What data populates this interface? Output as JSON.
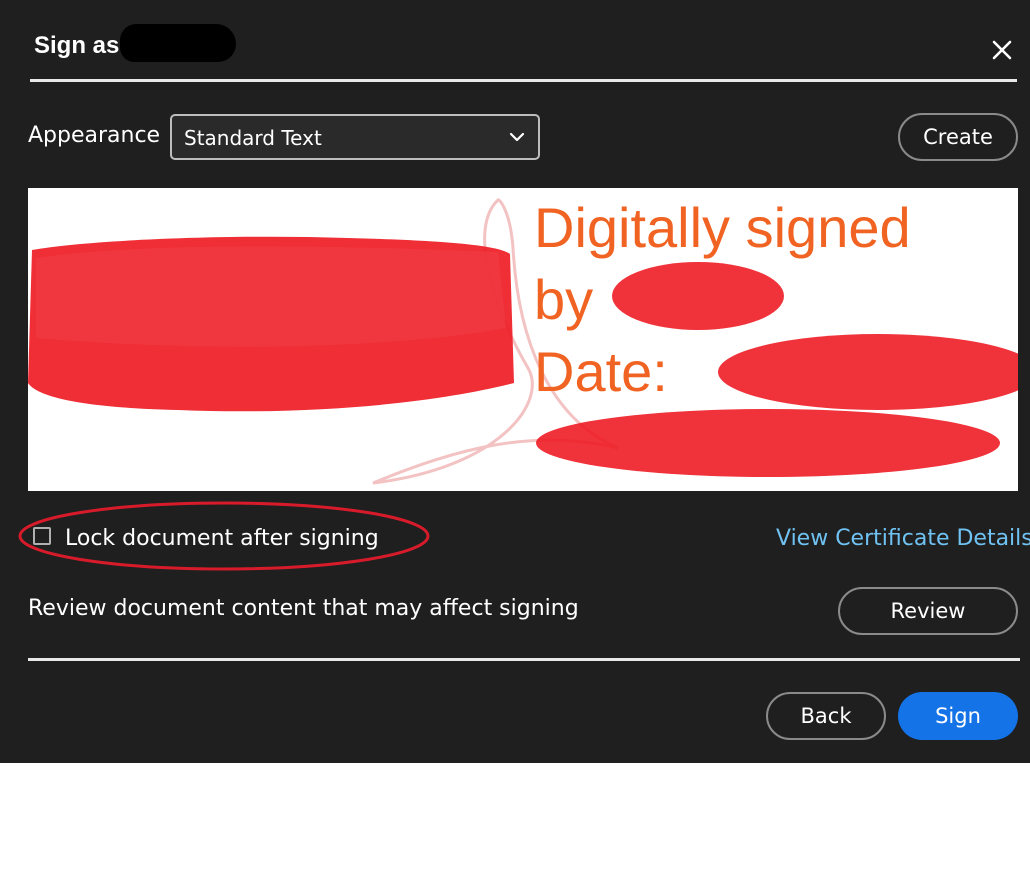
{
  "dialog": {
    "title": "Sign as",
    "close_icon": "close-icon"
  },
  "appearance": {
    "label": "Appearance",
    "selected": "Standard Text",
    "chevron_icon": "chevron-down-icon",
    "create_label": "Create"
  },
  "preview": {
    "line1": "Digitally signed",
    "line2": "by",
    "line3": "Date:"
  },
  "options": {
    "lock_label": "Lock document after signing",
    "lock_checked": false,
    "view_certificate_label": "View Certificate Details",
    "review_text": "Review document content that may affect signing",
    "review_label": "Review"
  },
  "footer": {
    "back_label": "Back",
    "sign_label": "Sign"
  },
  "colors": {
    "dialog_bg": "#1f1f1f",
    "accent_blue": "#1473e6",
    "link_blue": "#6fc2f2",
    "signature_orange": "#f06322",
    "redaction_red": "#ee1c25",
    "annotation_red": "#d81b2a"
  }
}
